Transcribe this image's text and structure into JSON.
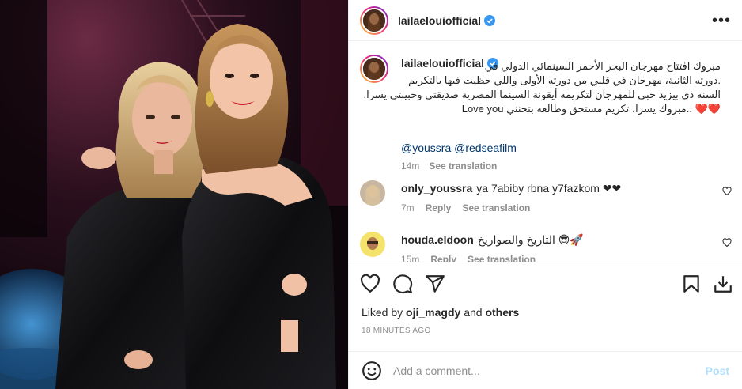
{
  "post": {
    "username": "lailaelouiofficial",
    "more_icon": "more-horizontal-icon"
  },
  "caption": {
    "username": "lailaelouiofficial",
    "lines": [
      "مبروك افتتاح مهرجان البحر الأحمر السينمائي الدولي في",
      ".دورته الثانية، مهرجان في قلبي من دورته الأولى واللي حظيت فيها بالتكريم",
      "السنه دي بيزيد حبي للمهرجان لتكريمه أيقونة السينما المصرية صديقتي وحبيبتي يسرا.",
      "..مبروك يسرا، تكريم مستحق وطالعه بتجنني Love you"
    ],
    "hearts": "❤️❤️",
    "mentions": "@youssra @redseafilm",
    "time": "14m",
    "translate": "See translation"
  },
  "comments": [
    {
      "username": "only_youssra",
      "text": "ya 7abiby rbna y7fazkom ❤❤",
      "time": "7m",
      "reply": "Reply",
      "translate": "See translation"
    },
    {
      "username": "houda.eldoon",
      "text": "التاريخ والصواريخ 😎🚀",
      "time": "15m",
      "reply": "Reply",
      "translate": "See translation"
    }
  ],
  "actions": {
    "icons": [
      "heart-icon",
      "comment-icon",
      "share-icon",
      "bookmark-icon",
      "download-icon"
    ]
  },
  "likes": {
    "prefix": "Liked by",
    "user": "oji_magdy",
    "and": "and",
    "others": "others"
  },
  "timestamp": "18 MINUTES AGO",
  "add_comment": {
    "placeholder": "Add a comment...",
    "post_label": "Post"
  },
  "colors": {
    "link": "#00376b",
    "post_disabled": "#b2dffc",
    "muted": "#8e8e8e",
    "verified": "#3897f0",
    "heart": "#e0245e"
  }
}
